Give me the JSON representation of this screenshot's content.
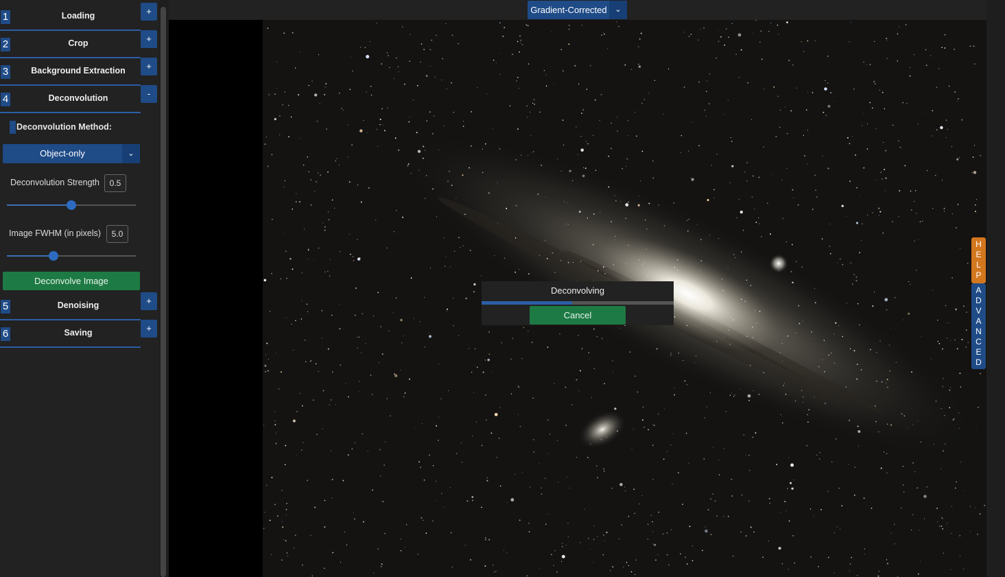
{
  "sidebar": {
    "steps": [
      {
        "num": "1",
        "title": "Loading",
        "toggle": "+"
      },
      {
        "num": "2",
        "title": "Crop",
        "toggle": "+"
      },
      {
        "num": "3",
        "title": "Background Extraction",
        "toggle": "+"
      },
      {
        "num": "4",
        "title": "Deconvolution",
        "toggle": "-"
      },
      {
        "num": "5",
        "title": "Denoising",
        "toggle": "+"
      },
      {
        "num": "6",
        "title": "Saving",
        "toggle": "+"
      }
    ],
    "deconvolution": {
      "method_label": "Deconvolution Method:",
      "method_value": "Object-only",
      "strength_label": "Deconvolution Strength",
      "strength_value": "0.5",
      "strength_fraction": 0.5,
      "fwhm_label": "Image FWHM (in pixels)",
      "fwhm_value": "5.0",
      "fwhm_fraction": 0.36,
      "action_button": "Deconvolve Image"
    }
  },
  "topbar": {
    "view_select_value": "Gradient-Corrected",
    "dropdown_icon": "chevron-down-icon"
  },
  "side_tabs": {
    "help": "HELP",
    "advanced": "ADVANCED"
  },
  "progress": {
    "title": "Deconvolving",
    "fraction": 0.47,
    "cancel_label": "Cancel"
  },
  "colors": {
    "accent_blue": "#1f4b87",
    "action_green": "#1e7a44",
    "help_orange": "#d3771f"
  }
}
